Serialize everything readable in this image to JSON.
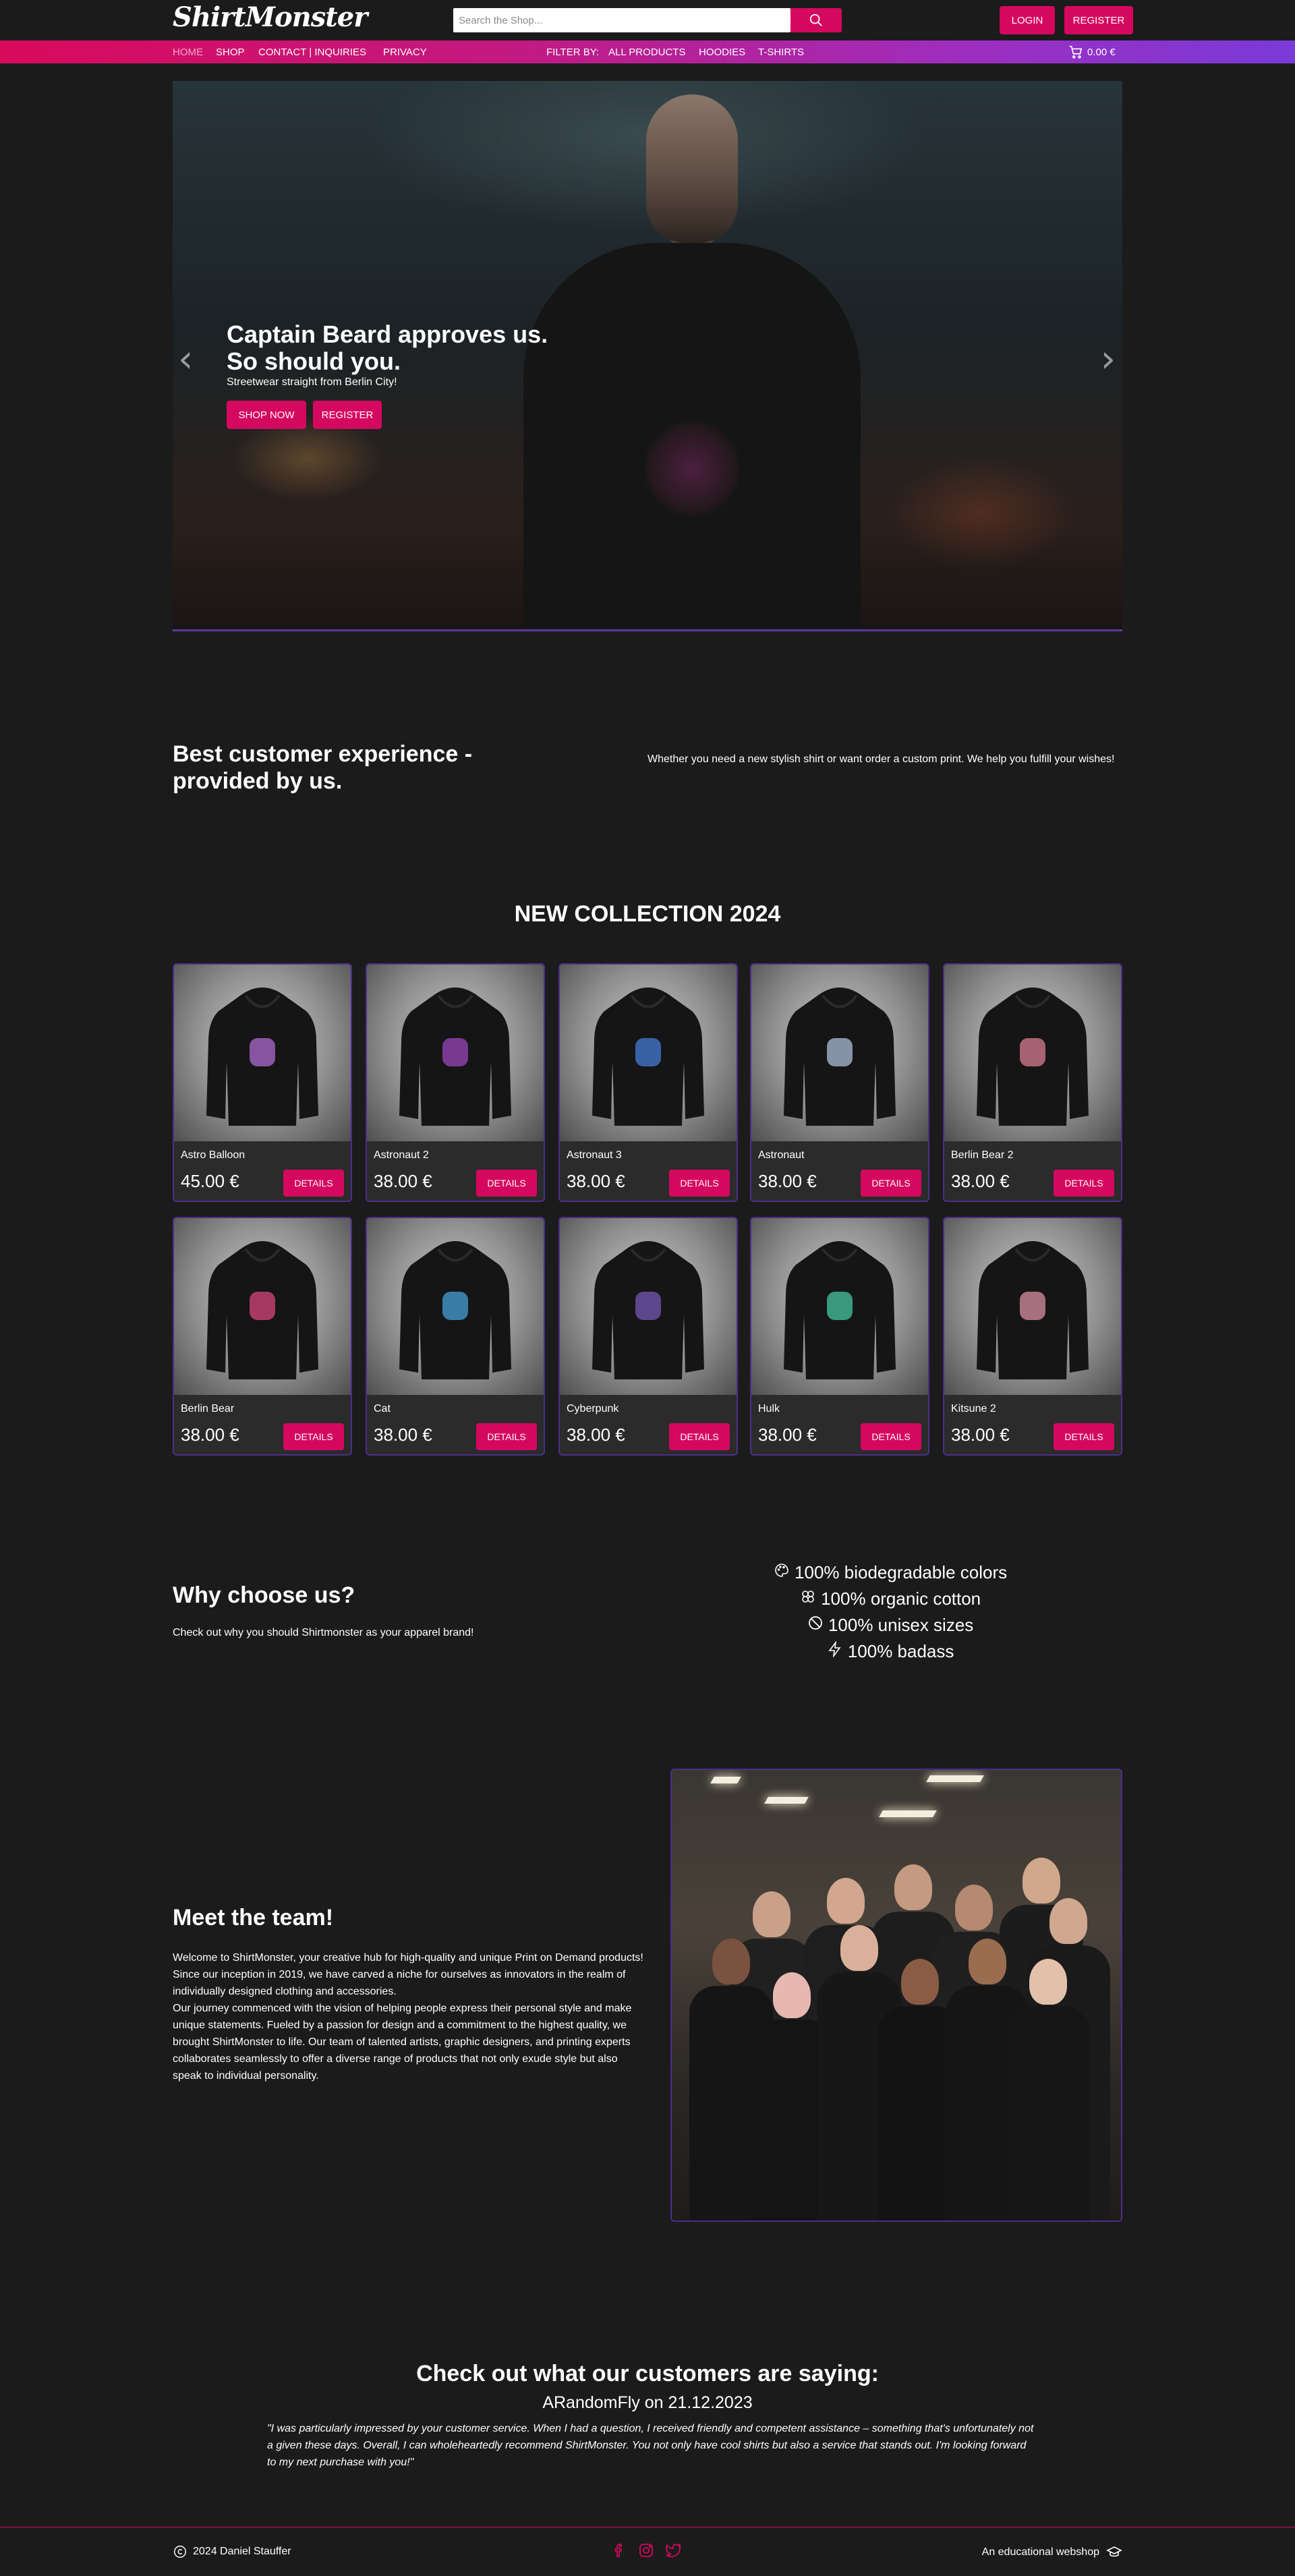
{
  "header": {
    "logo": "ShirtMonster",
    "search_placeholder": "Search the Shop...",
    "login": "LOGIN",
    "register": "REGISTER"
  },
  "nav": {
    "home": "HOME",
    "shop": "SHOP",
    "contact": "CONTACT | INQUIRIES",
    "privacy": "PRIVACY",
    "filter_by": "FILTER BY:",
    "all_products": "ALL PRODUCTS",
    "hoodies": "HOODIES",
    "tshirts": "T-SHIRTS",
    "cart_total": "0.00 €"
  },
  "hero": {
    "title": "Captain Beard approves us. So should you.",
    "subtitle": "Streetwear straight from Berlin City!",
    "shop_now": "SHOP NOW",
    "register": "REGISTER"
  },
  "best": {
    "heading": "Best customer experience - provided by us.",
    "text": "Whether you need a new stylish shirt or want order a custom print. We help you fulfill your wishes!"
  },
  "collection": {
    "title": "NEW COLLECTION 2024",
    "details_label": "DETAILS",
    "products": [
      {
        "name": "Astro Balloon",
        "price": "45.00 €",
        "print": "#9a5fb8"
      },
      {
        "name": "Astronaut 2",
        "price": "38.00 €",
        "print": "#8a3fa8"
      },
      {
        "name": "Astronaut 3",
        "price": "38.00 €",
        "print": "#3f6fc0"
      },
      {
        "name": "Astronaut",
        "price": "38.00 €",
        "print": "#9aa8c0"
      },
      {
        "name": "Berlin Bear 2",
        "price": "38.00 €",
        "print": "#c07080"
      },
      {
        "name": "Berlin Bear",
        "price": "38.00 €",
        "print": "#c04070"
      },
      {
        "name": "Cat",
        "price": "38.00 €",
        "print": "#3f8fbf"
      },
      {
        "name": "Cyberpunk",
        "price": "38.00 €",
        "print": "#6a4fa0"
      },
      {
        "name": "Hulk",
        "price": "38.00 €",
        "print": "#3fb08f"
      },
      {
        "name": "Kitsune 2",
        "price": "38.00 €",
        "print": "#c08090"
      }
    ]
  },
  "why": {
    "heading": "Why choose us?",
    "text": "Check out why you should Shirtmonster as your apparel brand!",
    "points": [
      {
        "icon": "palette-icon",
        "text": "100% biodegradable colors"
      },
      {
        "icon": "cotton-icon",
        "text": "100% organic cotton"
      },
      {
        "icon": "ban-icon",
        "text": "100% unisex sizes"
      },
      {
        "icon": "lightning-icon",
        "text": "100% badass"
      }
    ]
  },
  "team": {
    "heading": "Meet the team!",
    "paragraph1": "Welcome to ShirtMonster, your creative hub for high-quality and unique Print on Demand products! Since our inception in 2019, we have carved a niche for ourselves as innovators in the realm of individually designed clothing and accessories.",
    "paragraph2": "Our journey commenced with the vision of helping people express their personal style and make unique statements. Fueled by a passion for design and a commitment to the highest quality, we brought ShirtMonster to life. Our team of talented artists, graphic designers, and printing experts collaborates seamlessly to offer a diverse range of products that not only exude style but also speak to individual personality."
  },
  "customers": {
    "heading": "Check out what our customers are saying:",
    "reviewer": "ARandomFly on 21.12.2023",
    "quote": "\"I was particularly impressed by your customer service. When I had a question, I received friendly and competent assistance – something that's unfortunately not a given these days. Overall, I can wholeheartedly recommend ShirtMonster. You not only have cool shirts but also a service that stands out. I'm looking forward to my next purchase with you!\""
  },
  "footer": {
    "copyright": "2024 Daniel Stauffer",
    "tagline": "An educational webshop"
  },
  "colors": {
    "accent": "#d5085f",
    "card_border": "#4a2f8a",
    "background": "#1b1b1b"
  }
}
